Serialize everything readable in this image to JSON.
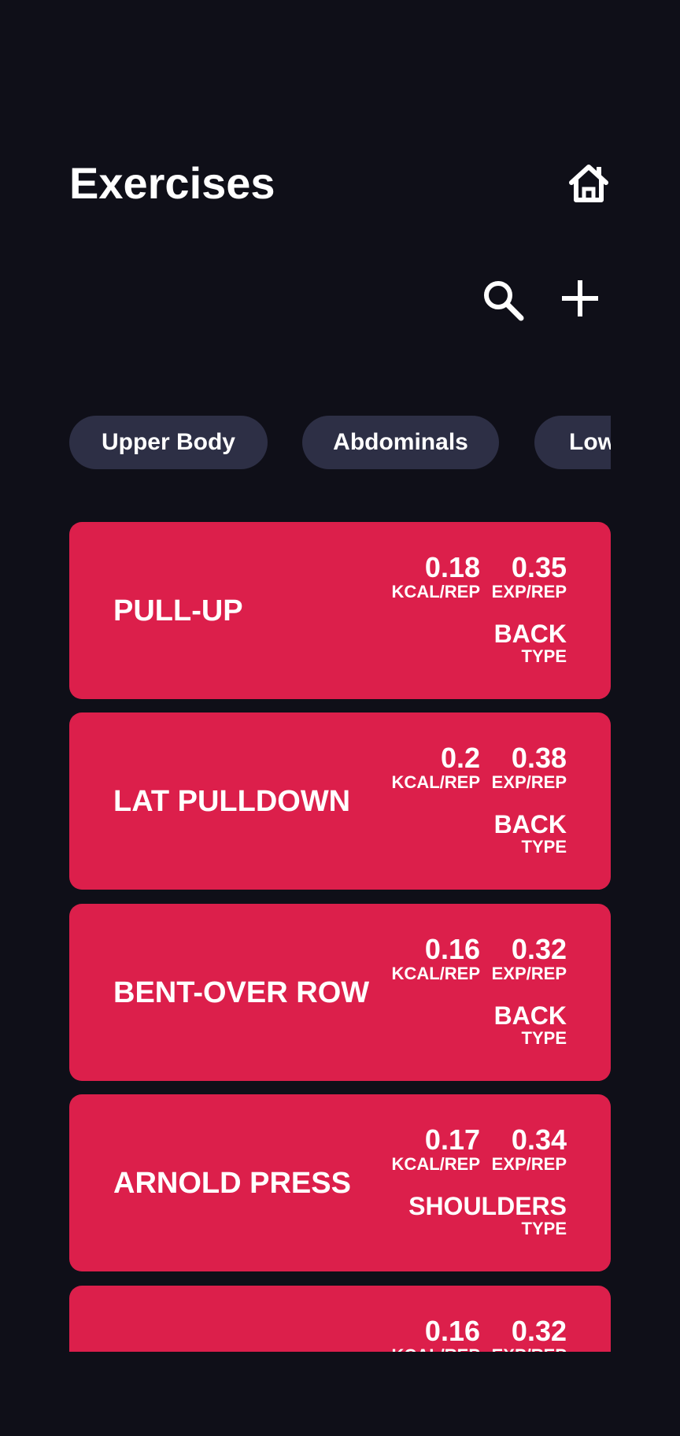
{
  "header": {
    "title": "Exercises"
  },
  "toolbar": {
    "home_icon": "home-icon",
    "search_icon": "search-icon",
    "add_icon": "plus-icon"
  },
  "filters": [
    {
      "label": "Upper Body"
    },
    {
      "label": "Abdominals"
    },
    {
      "label": "Low"
    }
  ],
  "labels": {
    "kcal": "KCAL/REP",
    "exp": "EXP/REP",
    "type": "TYPE"
  },
  "exercises": [
    {
      "name": "PULL-UP",
      "kcal": "0.18",
      "exp": "0.35",
      "type": "BACK"
    },
    {
      "name": "LAT PULLDOWN",
      "kcal": "0.2",
      "exp": "0.38",
      "type": "BACK"
    },
    {
      "name": "BENT-OVER ROW",
      "kcal": "0.16",
      "exp": "0.32",
      "type": "BACK"
    },
    {
      "name": "ARNOLD PRESS",
      "kcal": "0.17",
      "exp": "0.34",
      "type": "SHOULDERS"
    },
    {
      "name": "",
      "kcal": "0.16",
      "exp": "0.32",
      "type": ""
    }
  ],
  "colors": {
    "background": "#0f0f18",
    "card": "#dc1f4b",
    "chip": "#2d2f45",
    "text": "#ffffff"
  }
}
